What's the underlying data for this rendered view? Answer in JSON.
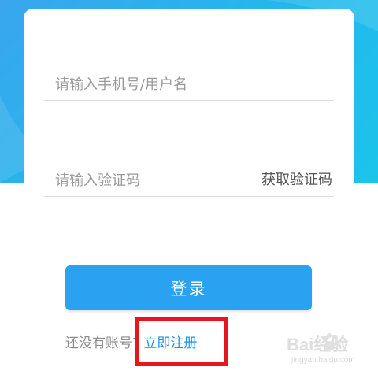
{
  "colors": {
    "accent": "#29a3f1",
    "link": "#1e94e6",
    "highlight": "#e8161c",
    "header_gradient_start": "#3aa6ee",
    "header_gradient_end": "#1cc4ea"
  },
  "form": {
    "phone_placeholder": "请输入手机号/用户名",
    "code_placeholder": "请输入验证码",
    "get_code_label": "获取验证码",
    "login_label": "登录"
  },
  "register": {
    "prompt": "还没有账号?",
    "link_label": "立即注册"
  },
  "watermark": {
    "main": "Bai经验",
    "sub": "jingyan.baidu.com",
    "icon": "paw-icon"
  }
}
